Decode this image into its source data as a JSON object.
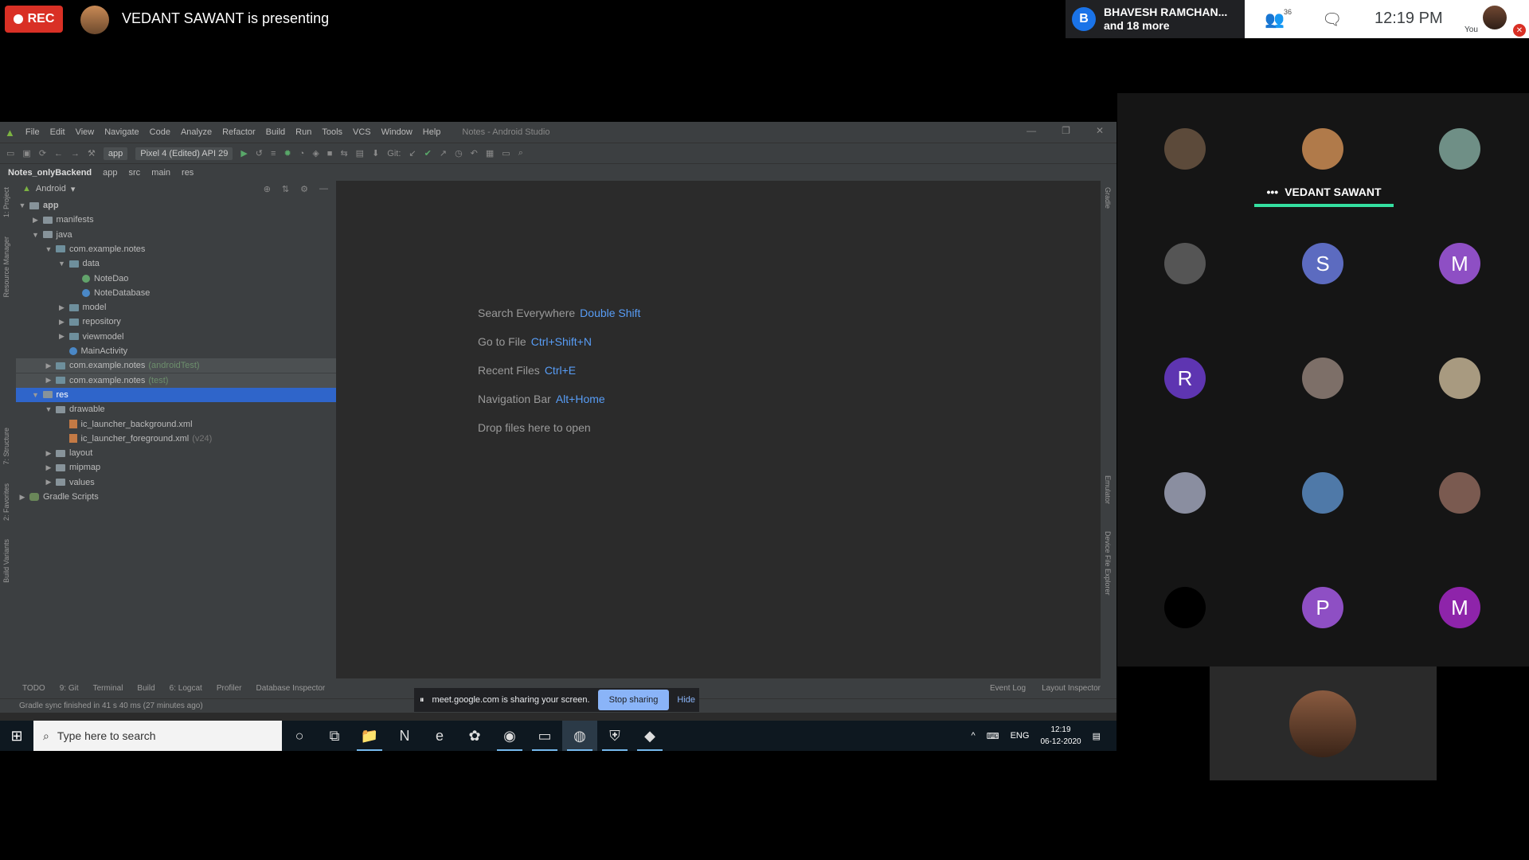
{
  "meet": {
    "rec_label": "REC",
    "presenting": "VEDANT SAWANT is presenting",
    "speaker_initial": "B",
    "speaker_line1": "BHAVESH RAMCHAN...",
    "speaker_line2": "and 18 more",
    "people_count": "36",
    "time": "12:19 PM",
    "you_label": "You",
    "speaking_name": "VEDANT SAWANT",
    "share_text": "meet.google.com is sharing your screen.",
    "stop_sharing": "Stop sharing",
    "hide": "Hide",
    "tiles": [
      {
        "initial": "",
        "color": "#5c4a3a"
      },
      {
        "initial": "",
        "color": "#b07a4a"
      },
      {
        "initial": "",
        "color": "#6f8f86"
      },
      {
        "initial": "",
        "color": "#555555"
      },
      {
        "initial": "S",
        "color": "#5c6bc0"
      },
      {
        "initial": "M",
        "color": "#8e4fc4"
      },
      {
        "initial": "R",
        "color": "#5e35b1"
      },
      {
        "initial": "",
        "color": "#7d6f68"
      },
      {
        "initial": "",
        "color": "#a89a80"
      },
      {
        "initial": "",
        "color": "#8a8ea0"
      },
      {
        "initial": "",
        "color": "#4f79a8"
      },
      {
        "initial": "",
        "color": "#7a5a50"
      },
      {
        "initial": "",
        "color": "#000000"
      },
      {
        "initial": "P",
        "color": "#8e4fc4"
      },
      {
        "initial": "M",
        "color": "#8e24aa"
      }
    ]
  },
  "studio": {
    "menu": [
      "File",
      "Edit",
      "View",
      "Navigate",
      "Code",
      "Analyze",
      "Refactor",
      "Build",
      "Run",
      "Tools",
      "VCS",
      "Window",
      "Help"
    ],
    "window_title": "Notes - Android Studio",
    "toolbar_app": "app",
    "toolbar_device": "Pixel 4 (Edited) API 29",
    "toolbar_git": "Git:",
    "breadcrumb": [
      "Notes_onlyBackend",
      "app",
      "src",
      "main",
      "res"
    ],
    "panel_view": "Android",
    "tree": [
      {
        "label": "app",
        "depth": 0,
        "arrow": "open",
        "icon": "folder",
        "bold": true
      },
      {
        "label": "manifests",
        "depth": 1,
        "arrow": "closed",
        "icon": "folder"
      },
      {
        "label": "java",
        "depth": 1,
        "arrow": "open",
        "icon": "folder"
      },
      {
        "label": "com.example.notes",
        "depth": 2,
        "arrow": "open",
        "icon": "pkg"
      },
      {
        "label": "data",
        "depth": 3,
        "arrow": "open",
        "icon": "pkg"
      },
      {
        "label": "NoteDao",
        "depth": 4,
        "arrow": "",
        "icon": "iface"
      },
      {
        "label": "NoteDatabase",
        "depth": 4,
        "arrow": "",
        "icon": "class"
      },
      {
        "label": "model",
        "depth": 3,
        "arrow": "closed",
        "icon": "pkg"
      },
      {
        "label": "repository",
        "depth": 3,
        "arrow": "closed",
        "icon": "pkg"
      },
      {
        "label": "viewmodel",
        "depth": 3,
        "arrow": "closed",
        "icon": "pkg"
      },
      {
        "label": "MainActivity",
        "depth": 3,
        "arrow": "",
        "icon": "class"
      },
      {
        "label": "com.example.notes",
        "depth": 2,
        "arrow": "closed",
        "icon": "pkg",
        "suffix": "(androidTest)",
        "hl": true
      },
      {
        "label": "com.example.notes",
        "depth": 2,
        "arrow": "closed",
        "icon": "pkg",
        "suffix": "(test)",
        "hl": true
      },
      {
        "label": "res",
        "depth": 1,
        "arrow": "open",
        "icon": "folder",
        "sel": true
      },
      {
        "label": "drawable",
        "depth": 2,
        "arrow": "open",
        "icon": "folder"
      },
      {
        "label": "ic_launcher_background.xml",
        "depth": 3,
        "arrow": "",
        "icon": "xml"
      },
      {
        "label": "ic_launcher_foreground.xml",
        "depth": 3,
        "arrow": "",
        "icon": "xml",
        "suffix": "(v24)",
        "gray": true
      },
      {
        "label": "layout",
        "depth": 2,
        "arrow": "closed",
        "icon": "folder"
      },
      {
        "label": "mipmap",
        "depth": 2,
        "arrow": "closed",
        "icon": "folder"
      },
      {
        "label": "values",
        "depth": 2,
        "arrow": "closed",
        "icon": "folder"
      },
      {
        "label": "Gradle Scripts",
        "depth": 0,
        "arrow": "closed",
        "icon": "gradle"
      }
    ],
    "hints": [
      {
        "text": "Search Everywhere",
        "key": "Double Shift"
      },
      {
        "text": "Go to File",
        "key": "Ctrl+Shift+N"
      },
      {
        "text": "Recent Files",
        "key": "Ctrl+E"
      },
      {
        "text": "Navigation Bar",
        "key": "Alt+Home"
      },
      {
        "text": "Drop files here to open",
        "key": ""
      }
    ],
    "bottom_tabs": [
      "TODO",
      "9: Git",
      "Terminal",
      "Build",
      "6: Logcat",
      "Profiler",
      "Database Inspector"
    ],
    "right_tabs": [
      "Event Log",
      "Layout Inspector"
    ],
    "status": "Gradle sync finished in 41 s 40 ms (27 minutes ago)",
    "left_vtabs": [
      "1: Project",
      "Resource Manager",
      "7: Structure",
      "2: Favorites",
      "Build Variants"
    ],
    "right_vtabs": [
      "Gradle",
      "Emulator",
      "Device File Explorer"
    ]
  },
  "taskbar": {
    "search_placeholder": "Type here to search",
    "lang": "ENG",
    "time": "12:19",
    "date": "06-12-2020"
  }
}
